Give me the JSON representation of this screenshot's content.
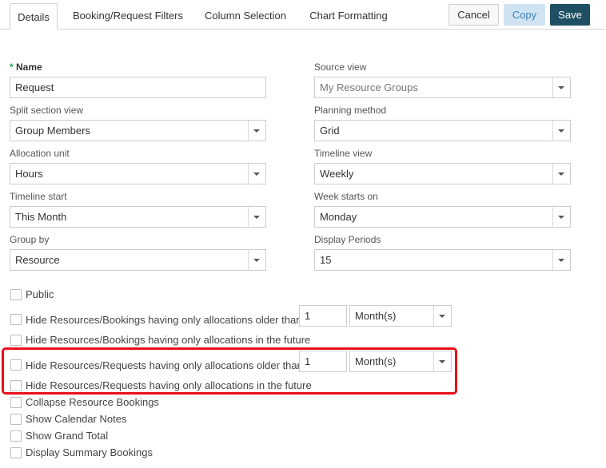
{
  "tabs": [
    "Details",
    "Booking/Request Filters",
    "Column Selection",
    "Chart Formatting"
  ],
  "buttons": {
    "cancel": "Cancel",
    "copy": "Copy",
    "save": "Save"
  },
  "fields": {
    "name": {
      "required_mark": "*",
      "label": "Name",
      "value": "Request"
    },
    "source_view": {
      "label": "Source view",
      "value": "My Resource Groups"
    },
    "split_section_view": {
      "label": "Split section view",
      "value": "Group Members"
    },
    "planning_method": {
      "label": "Planning method",
      "value": "Grid"
    },
    "allocation_unit": {
      "label": "Allocation unit",
      "value": "Hours"
    },
    "timeline_view": {
      "label": "Timeline view",
      "value": "Weekly"
    },
    "timeline_start": {
      "label": "Timeline start",
      "value": "This Month"
    },
    "week_starts_on": {
      "label": "Week starts on",
      "value": "Monday"
    },
    "group_by": {
      "label": "Group by",
      "value": "Resource"
    },
    "display_periods": {
      "label": "Display Periods",
      "value": "15"
    }
  },
  "checkboxes": {
    "public": "Public",
    "hide_bookings_older": "Hide Resources/Bookings having only allocations older than",
    "hide_bookings_future": "Hide Resources/Bookings having only allocations in the future",
    "hide_requests_older": "Hide Resources/Requests having only allocations older than",
    "hide_requests_future": "Hide Resources/Requests having only allocations in the future",
    "collapse_bookings": "Collapse Resource Bookings",
    "show_calendar_notes": "Show Calendar Notes",
    "show_grand_total": "Show Grand Total",
    "display_summary_bookings": "Display Summary Bookings"
  },
  "older_than": {
    "bookings": {
      "count": "1",
      "unit": "Month(s)"
    },
    "requests": {
      "count": "1",
      "unit": "Month(s)"
    }
  },
  "colors": {
    "save": "#1f4f63",
    "copy": "#cfe3f3",
    "highlight": "#e8101a",
    "required": "#2d9c3c"
  },
  "icons": [
    "chevron-down-icon",
    "checkbox-icon"
  ]
}
